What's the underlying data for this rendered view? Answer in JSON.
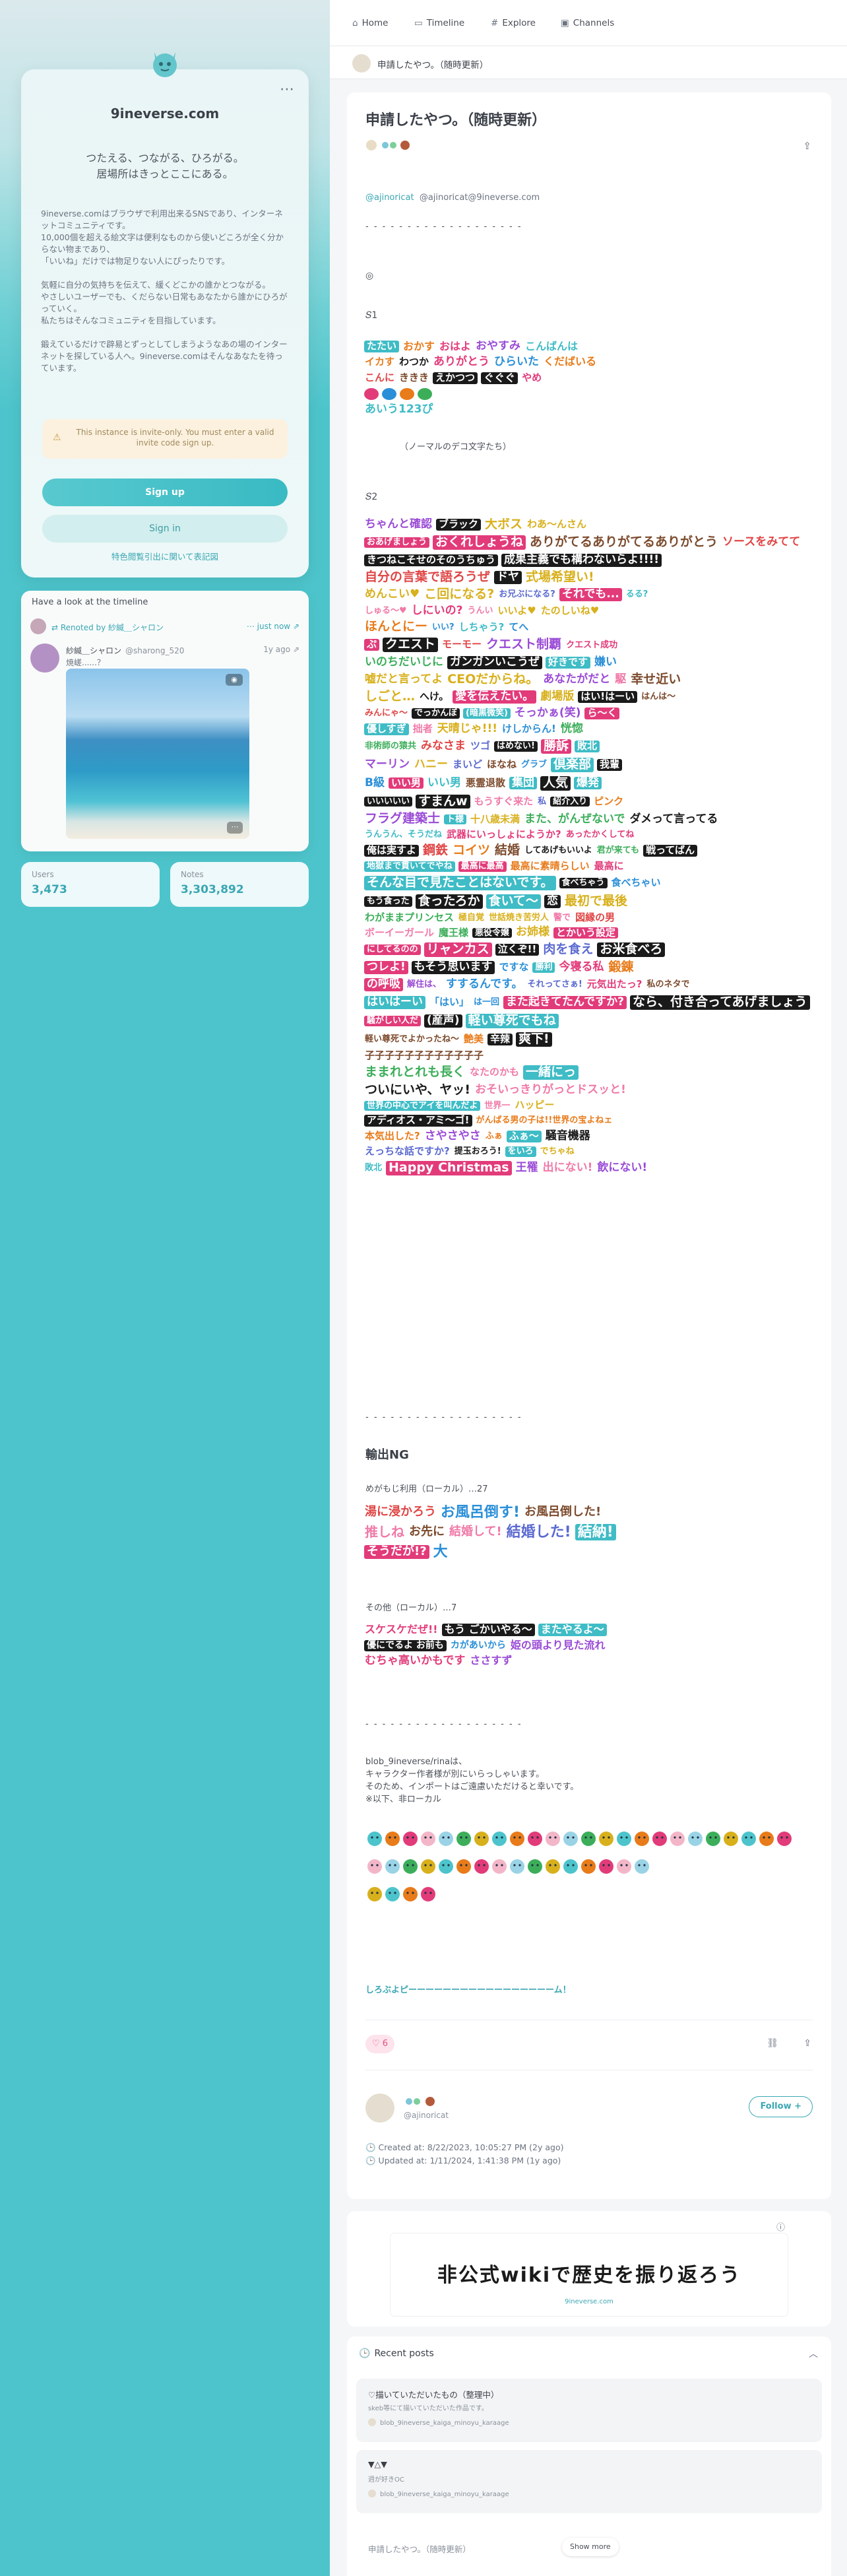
{
  "sidebar": {
    "instance_name": "9ineverse.com",
    "tagline": "つたえる、つながる、ひろがる。\n居場所はきっとここにある。",
    "description": "9ineverse.comはブラウザで利用出来るSNSであり、インターネットコミュニティです。\n10,000個を超える絵文字は便利なものから使いどころが全く分からない物まであり、\n「いいね」だけでは物足りない人にぴったりです。\n\n気軽に自分の気持ちを伝えて、緩くどこかの誰かとつながる。\nやさしいユーザーでも、くだらない日常もあなたから誰かにひろがっていく。\n私たちはそんなコミュニティを目指しています。\n\n鍛えているだけで辟易とずっとしてしまうようなあの場のインターネットを探している人へ。9ineverse.comはそんなあなたを待っています。",
    "notice": "This instance is invite-only. You must enter a valid invite code sign up.",
    "signup_label": "Sign up",
    "signin_label": "Sign in",
    "wiki_link": "特色閲覧引出に関いて表記図",
    "timeline_heading": "Have a look at the timeline",
    "renote_text": "Renoted by 紗緘＿シャロン",
    "renote_time": "just now",
    "note_user": "紗緘＿シャロン",
    "note_acct": "@sharong_520",
    "note_time": "1y ago",
    "note_body": "焼嵯......？",
    "users_label": "Users",
    "users_value": "3,473",
    "notes_label": "Notes",
    "notes_value": "3,303,892"
  },
  "topnav": {
    "home": "Home",
    "timeline": "Timeline",
    "explore": "Explore",
    "channels": "Channels"
  },
  "pagebar": {
    "title": "申請したやつ。（随時更新）"
  },
  "page": {
    "title": "申請したやつ。（随時更新）",
    "author_mention": "@ajinoricat",
    "author_full": "@ajinoricat@9ineverse.com",
    "dash": "- - - - - - - - - - - - - - - - - - -",
    "circle_mark": "◎",
    "section1": "𝑆1",
    "section2": "𝑆2",
    "normal_note": "（ノーマルのデコ文字たち）",
    "ng_heading": "輸出NG",
    "ng_local": "めがもじ利用（ローカル）…27",
    "other_local": "その他（ローカル）…7",
    "blob_note": "blob_9ineverse/rinaは、\nキャラクター作者様が別にいらっしゃいます。\nそのため、インポートはご遠慮いただけると幸いです。\n※以下、非ローカル",
    "last_line": "しろぶよピーーーーーーーーーーーーーーーーーム！",
    "likes": "6",
    "author_acct": "@ajinoricat",
    "follow_label": "Follow",
    "created": "Created at: 8/22/2023, 10:05:27 PM (2y ago)",
    "updated": "Updated at: 1/11/2024, 1:41:38 PM (1y ago)"
  },
  "wiki_banner": {
    "title": "非公式wikiで歴史を振り返ろう",
    "subtitle": "9ineverse.com"
  },
  "recent": {
    "heading": "Recent posts",
    "posts": [
      {
        "title": "♡描いていただいたもの（整理中）",
        "desc": "skeb等にて描いていただいた作品です。",
        "user": "blob_9ineverse_kaiga_minoyu_karaage"
      },
      {
        "title": "▼△▼",
        "desc": "週が好きOC",
        "user": "blob_9ineverse_kaiga_minoyu_karaage"
      }
    ],
    "faded_title": "申請したやつ。（随時更新）",
    "show_more": "Show more"
  },
  "emoji_text": {
    "s1_rows": [
      [
        "たたい",
        "おかす",
        "おはよ",
        "おやすみ",
        "こんばんは"
      ],
      [
        "イカす",
        "わつか",
        "ありがとう",
        "ひらいた",
        "くだばいる"
      ],
      [
        "こんに",
        "ききき",
        "えかつつ",
        "ぐぐぐ",
        "やめ"
      ],
      [
        "",
        "",
        "",
        ""
      ]
    ],
    "s1_last": "あいう123ぴ",
    "s2_rows": [
      [
        "ちゃんと確認",
        "ブラック",
        "大ボス",
        "わあ〜んさん"
      ],
      [
        "おあげましょう",
        "おくれしょうね",
        "ありがてるありがてるありがとう",
        "ソースをみてて"
      ],
      [
        "きつねこそせのそのうちゅう",
        "成果主義でも構わないらよ!!!!"
      ],
      [
        "自分の言葉で語ろうぜ",
        "ドヤ",
        "式場希望い!"
      ],
      [
        "めんこい♥",
        "こ回になる?",
        "お兄ぶになる?",
        "それでも...",
        "るる?"
      ],
      [
        "しゅる〜♥",
        "しにいの?",
        "うんい",
        "いいよ♥",
        "たのしいね♥"
      ],
      [
        "ほんとにー",
        "いい?",
        "しちゃう?",
        "てへ"
      ],
      [
        "ぷ",
        "クエスト",
        "モーモー",
        "クエスト制覇",
        "クエスト成功"
      ],
      [
        "いのちだいじに",
        "ガンガンいこうぜ",
        "好きです",
        "嫌い"
      ],
      [
        "嘘だと言ってよ",
        "CEOだからね。",
        "あなたがだと",
        "駆",
        "幸せ近い"
      ],
      [
        "しごと…",
        "へけ。",
        "愛を伝えたい。",
        "劇場版",
        "はい!はーい",
        "はんは〜"
      ],
      [
        "みんにゃ〜",
        "でっかんぼ",
        "(暗黒微笑)",
        "そっかぁ(笑)",
        "ら〜く"
      ],
      [
        "優しすぎ",
        "拙者",
        "天晴じゃ!!!",
        "けしからん!",
        "恍惚"
      ],
      [
        "非術師の猿共",
        "みなさま",
        "ツゴ",
        "はめない!",
        "勝訴",
        "敗北"
      ],
      [
        "マーリン",
        "ハニー",
        "まいど",
        "ほなね",
        "グラブ",
        "倶楽部",
        "我輩"
      ],
      [
        "B級",
        "いい男",
        "いい男",
        "悪霊退散",
        "集団",
        "人気",
        "爆発"
      ],
      [
        "いいいいい",
        "すまんw",
        "もうすぐ来た",
        "私",
        "紹介入り",
        "ピンク"
      ],
      [
        "フラグ建築士",
        "ト様",
        "十八歳未満",
        "また、がんぜないで",
        "ダメって言ってる"
      ],
      [
        "うんうん、そうだね",
        "武器にいっしょにようか?",
        "あったかくしてね"
      ],
      [
        "俺は実すよ",
        "鋼鉄",
        "コイツ",
        "結婚",
        "してあげもいいよ",
        "君が来ても",
        "戦ってばん"
      ],
      [
        "地獄まで貫いてでやね",
        "最高に最高",
        "最高に素晴らしい",
        "最高に"
      ],
      [
        "そんな目で見たことはないです。",
        "食べちゃう",
        "食べちゃい"
      ],
      [
        "もう食った",
        "食ったろか",
        "食いて〜",
        "恋",
        "最初で最後"
      ],
      [
        "わがままプリンセス",
        "極自覚",
        "世話焼き苦労人",
        "警で",
        "図縁の男"
      ],
      [
        "ボーイーガール",
        "魔王様",
        "悪役令嬢",
        "お姉様",
        "とかいう設定"
      ],
      [
        "にしてるのの",
        "リャンカス",
        "泣くぞ!!",
        "肉を食え",
        "お米食べろ"
      ],
      [
        "つレよ!",
        "もそう思います",
        "ですな",
        "勝利",
        "今寝る私",
        "鍛錬"
      ],
      [
        "の呼吸",
        "解住は、",
        "すするんです。",
        "それってさぁ!",
        "元気出たっ?",
        "私のネタで"
      ],
      [
        "はいはーい",
        "「はい」",
        "は一回",
        "また起きてたんですか?",
        "なら、付き合ってあげましょう"
      ],
      [
        "騒がしい人だ",
        "(産声)",
        "軽い尊死でもね"
      ],
      [
        "軽い尊死でよかったね〜",
        "艶美",
        "辛辣",
        "爽下!"
      ],
      [
        "子子子子子子子子子子子子"
      ],
      [
        "ままれとれも長く",
        "なたのかも",
        "一緒にっ"
      ],
      [
        "ついにいや、ヤッ!",
        "おそいっきりがっとドスッと!"
      ],
      [
        "世界の中心でアイを叫んだよ",
        "世界一",
        "ハッピー"
      ],
      [
        "アディオス・アミ〜ゴ!",
        "がんばる男の子は!!世界の宝よねェ"
      ],
      [
        "本気出した?",
        "さやさやさ",
        "ふぁ",
        "ふぁ〜",
        "騒音機器"
      ],
      [
        "えっちな話ですか?",
        "提玉おろう!",
        "をいろ",
        "でちゃね"
      ],
      [
        "敗北",
        "Happy Christmas",
        "王罹",
        "出にない!",
        "飲にない!"
      ]
    ],
    "ng_rows": [
      [
        "湯に浸かろう",
        "お風呂倒す!",
        "お風呂倒した!"
      ],
      [
        "推しね",
        "お先に",
        "結婚して!",
        "結婚した!",
        "結納!"
      ],
      [
        "そうだが!?",
        "大"
      ]
    ],
    "other_rows": [
      [
        "スケスケだぜ!!",
        "もう ごかいやる〜",
        "またやるよ〜"
      ],
      [
        "優にでるよ お前も",
        "カがあいから",
        "姫の頭より見た流れ"
      ],
      [
        "むちゃ高いかもです",
        "ささすず"
      ]
    ]
  }
}
